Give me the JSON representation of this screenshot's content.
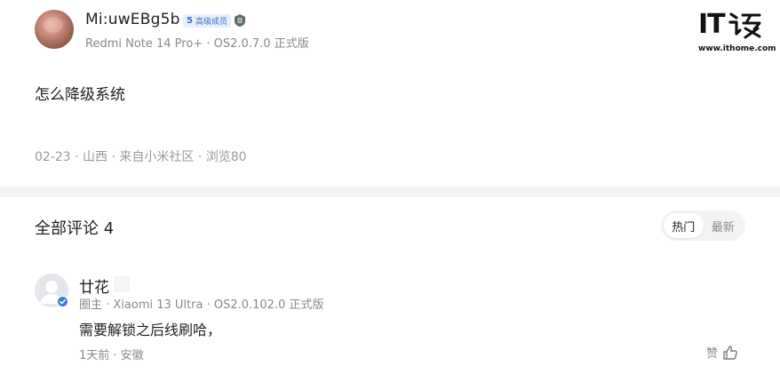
{
  "post": {
    "username": "Mi:uwEBg5b",
    "level_number": "5",
    "level_label": "高级成员",
    "device": "Redmi Note 14 Pro+ · OS2.0.7.0 正式版",
    "content": "怎么降级系统",
    "meta": "02-23 · 山西 · 来自小米社区 · 浏览80"
  },
  "watermark": {
    "mark": "IT",
    "url": "www.ithome.com"
  },
  "comments": {
    "title": "全部评论 4",
    "sort_options": [
      "热门",
      "最新"
    ],
    "active_sort": "热门",
    "items": [
      {
        "name": "廿花",
        "sub": "圈主 · Xiaomi 13 Ultra · OS2.0.102.0 正式版",
        "text": "需要解锁之后线刷哈，",
        "meta": "1天前 · 安徽",
        "like_label": "赞"
      }
    ]
  },
  "colors": {
    "badge_bg": "#e7effb",
    "badge_text": "#3d6fcf",
    "divider": "#f1f3f6",
    "verified": "#3a7be3"
  },
  "icons": [
    "medal-icon",
    "verified-icon",
    "thumbs-up-icon",
    "default-avatar-icon"
  ]
}
